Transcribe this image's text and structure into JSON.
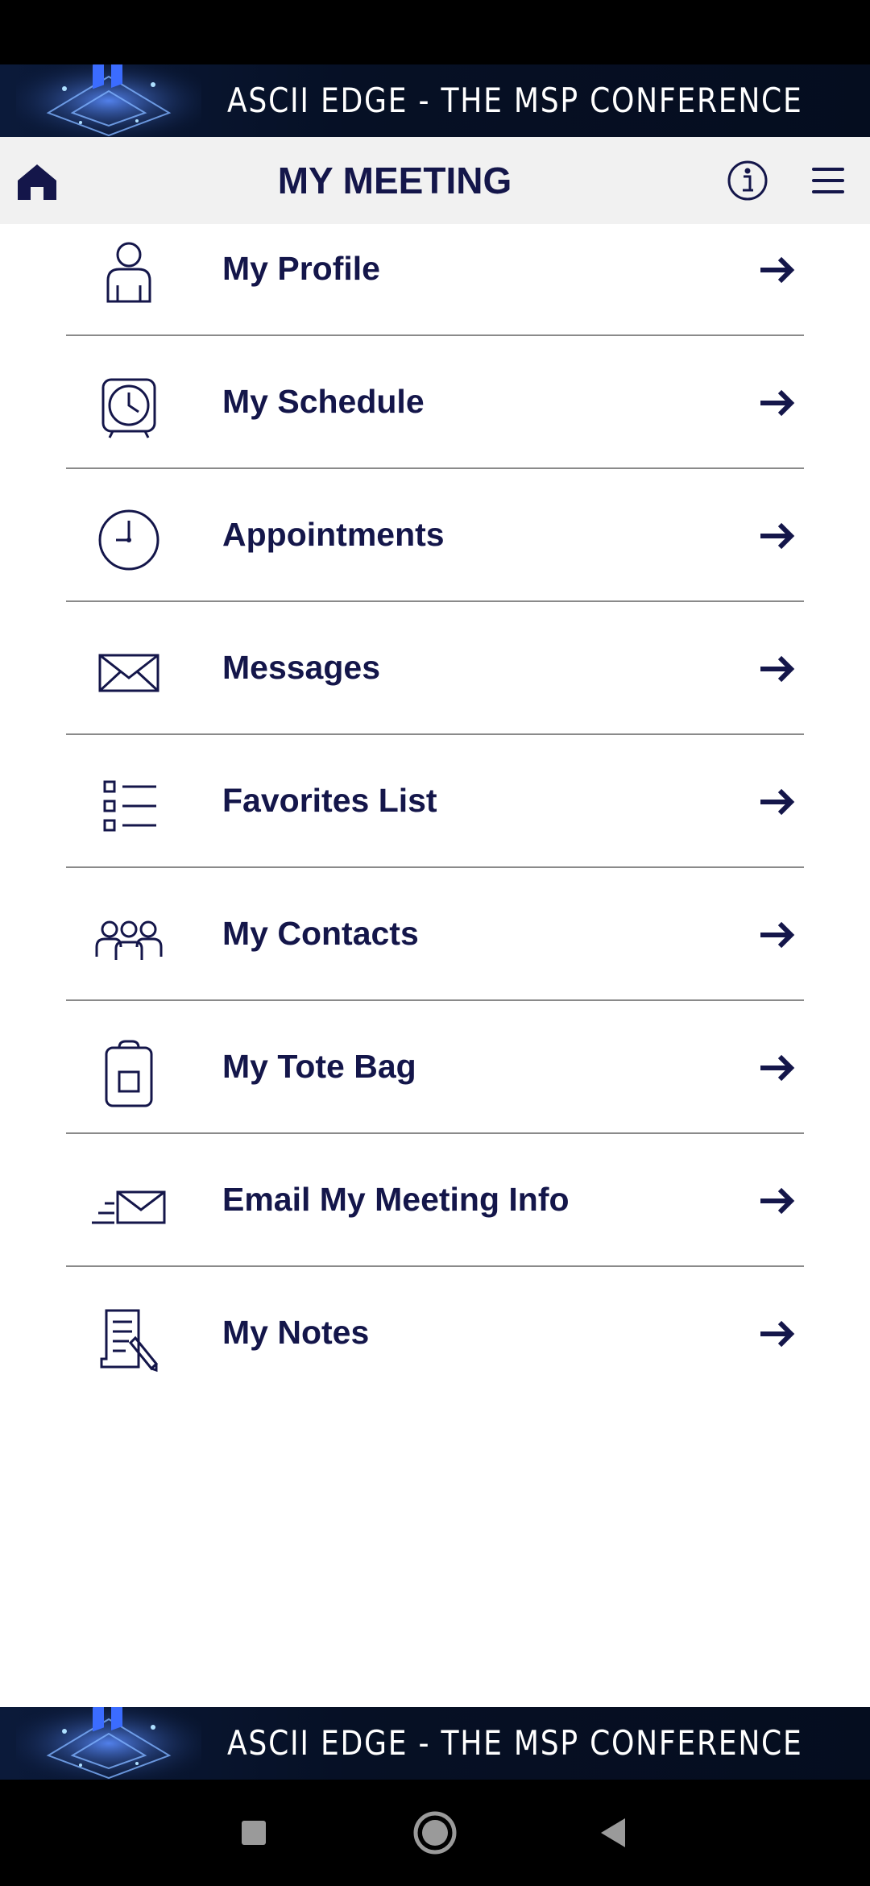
{
  "banner": {
    "text": "ASCII EDGE - THE MSP CONFERENCE"
  },
  "header": {
    "title": "MY MEETING"
  },
  "menu": [
    {
      "label": "My Profile",
      "icon": "person-icon"
    },
    {
      "label": "My Schedule",
      "icon": "alarm-clock-icon"
    },
    {
      "label": "Appointments",
      "icon": "clock-icon"
    },
    {
      "label": "Messages",
      "icon": "envelope-icon"
    },
    {
      "label": "Favorites List",
      "icon": "checklist-icon"
    },
    {
      "label": "My Contacts",
      "icon": "group-icon"
    },
    {
      "label": "My Tote Bag",
      "icon": "tote-bag-icon"
    },
    {
      "label": "Email My Meeting Info",
      "icon": "send-mail-icon"
    },
    {
      "label": "My Notes",
      "icon": "notes-icon"
    }
  ],
  "colors": {
    "text": "#14164a",
    "header_bg": "#f1f1f1",
    "banner_bg": "#061025",
    "divider": "#8a8a8a"
  },
  "system_nav": {
    "icons": [
      "recent-apps-icon",
      "home-circle-icon",
      "back-triangle-icon"
    ]
  }
}
